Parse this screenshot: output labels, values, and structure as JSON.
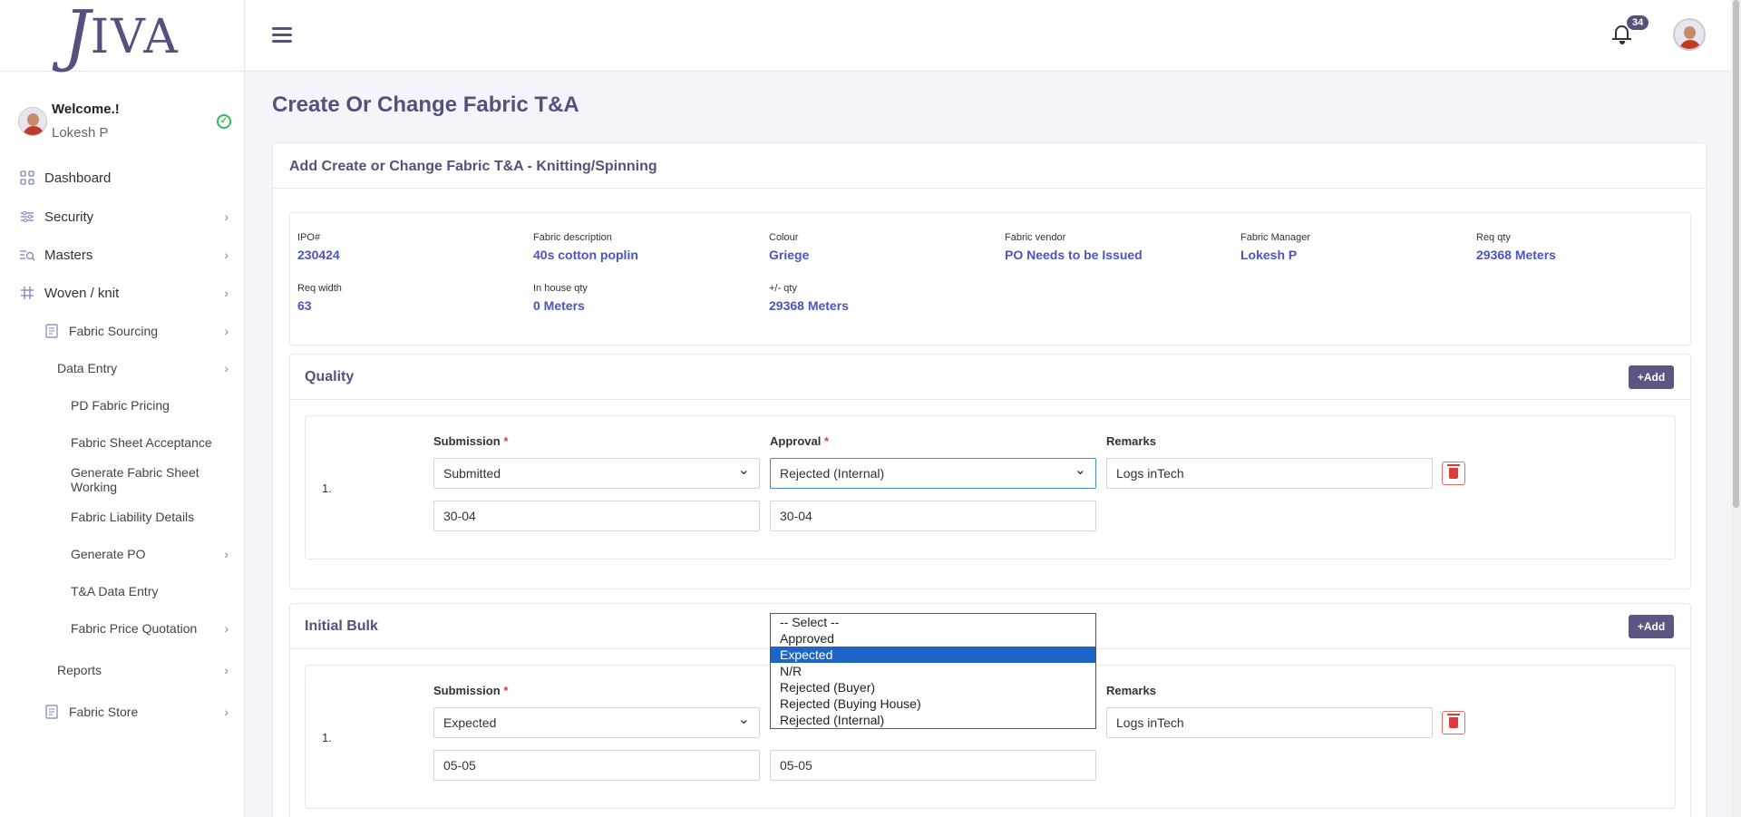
{
  "app": {
    "logo_j": "J",
    "logo_rest": "IVA"
  },
  "user": {
    "welcome": "Welcome.!",
    "name": "Lokesh P"
  },
  "notifications": {
    "count": "34"
  },
  "sidebar": {
    "items": [
      {
        "label": "Dashboard",
        "icon": "grid-icon"
      },
      {
        "label": "Security",
        "icon": "sliders-icon"
      },
      {
        "label": "Masters",
        "icon": "masters-icon"
      },
      {
        "label": "Woven / knit",
        "icon": "hash-icon"
      },
      {
        "label": "Fabric Sourcing",
        "icon": "doc-icon"
      },
      {
        "label": "Data Entry"
      },
      {
        "label": "PD Fabric Pricing"
      },
      {
        "label": "Fabric Sheet Acceptance"
      },
      {
        "label": "Generate Fabric Sheet Working"
      },
      {
        "label": "Fabric Liability Details"
      },
      {
        "label": "Generate PO"
      },
      {
        "label": "T&A Data Entry"
      },
      {
        "label": "Fabric Price Quotation"
      },
      {
        "label": "Reports"
      },
      {
        "label": "Fabric Store",
        "icon": "doc-icon"
      }
    ]
  },
  "page": {
    "title": "Create Or Change Fabric T&A",
    "card_title": "Add Create or Change Fabric T&A - Knitting/Spinning"
  },
  "info": {
    "ipo_label": "IPO#",
    "ipo": "230424",
    "desc_label": "Fabric description",
    "desc": "40s cotton poplin",
    "colour_label": "Colour",
    "colour": "Griege",
    "vendor_label": "Fabric vendor",
    "vendor": "PO Needs to be Issued",
    "manager_label": "Fabric Manager",
    "manager": "Lokesh P",
    "reqqty_label": "Req qty",
    "reqqty": "29368 Meters",
    "reqwidth_label": "Req width",
    "reqwidth": "63",
    "inhouse_label": "In house qty",
    "inhouse": "0 Meters",
    "diff_label": "+/- qty",
    "diff": "29368 Meters"
  },
  "quality": {
    "title": "Quality",
    "add_label": "+Add",
    "row_num": "1.",
    "submission_label": "Submission",
    "approval_label": "Approval",
    "remarks_label": "Remarks",
    "submission_value": "Submitted",
    "approval_value": "Rejected (Internal)",
    "remarks_value": "Logs inTech",
    "submission_date": "30-04",
    "approval_date": "30-04"
  },
  "bulk": {
    "title": "Initial Bulk",
    "add_label": "+Add",
    "row_num": "1.",
    "submission_label": "Submission",
    "remarks_label": "Remarks",
    "submission_value": "Expected",
    "remarks_value": "Logs inTech",
    "submission_date": "05-05",
    "approval_date": "05-05"
  },
  "dropdown": {
    "options": [
      "-- Select --",
      "Approved",
      "Expected",
      "N/R",
      "Rejected (Buyer)",
      "Rejected (Buying House)",
      "Rejected (Internal)"
    ],
    "selected": "Expected"
  },
  "required_mark": "*"
}
